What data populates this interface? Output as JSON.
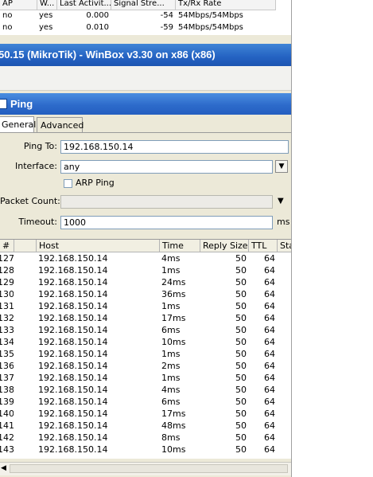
{
  "background_table": {
    "headers": [
      "AP",
      "W...",
      "Last Activit...",
      "Signal Stre...",
      "Tx/Rx Rate"
    ],
    "rows": [
      [
        "no",
        "yes",
        "0.000",
        "-54",
        "54Mbps/54Mbps"
      ],
      [
        "no",
        "yes",
        "0.010",
        "-59",
        "54Mbps/54Mbps"
      ]
    ]
  },
  "main_title": "50.15 (MikroTik) - WinBox v3.30 on x86 (x86)",
  "ping_window": {
    "title": "Ping",
    "tabs": [
      "General",
      "Advanced"
    ],
    "active_tab": "General",
    "fields": {
      "ping_to_label": "Ping To:",
      "ping_to_value": "192.168.150.14",
      "interface_label": "Interface:",
      "interface_value": "any",
      "arp_ping_label": "ARP Ping",
      "arp_ping_checked": false,
      "packet_count_label": "Packet Count:",
      "packet_count_value": "",
      "timeout_label": "Timeout:",
      "timeout_value": "1000",
      "timeout_unit": "ms"
    },
    "results": {
      "columns": [
        "#",
        "Host",
        "Time",
        "Reply Size",
        "TTL",
        "Sta"
      ],
      "rows": [
        [
          "127",
          "192.168.150.14",
          "4ms",
          "50",
          "64"
        ],
        [
          "128",
          "192.168.150.14",
          "1ms",
          "50",
          "64"
        ],
        [
          "129",
          "192.168.150.14",
          "24ms",
          "50",
          "64"
        ],
        [
          "130",
          "192.168.150.14",
          "36ms",
          "50",
          "64"
        ],
        [
          "131",
          "192.168.150.14",
          "1ms",
          "50",
          "64"
        ],
        [
          "132",
          "192.168.150.14",
          "17ms",
          "50",
          "64"
        ],
        [
          "133",
          "192.168.150.14",
          "6ms",
          "50",
          "64"
        ],
        [
          "134",
          "192.168.150.14",
          "10ms",
          "50",
          "64"
        ],
        [
          "135",
          "192.168.150.14",
          "1ms",
          "50",
          "64"
        ],
        [
          "136",
          "192.168.150.14",
          "2ms",
          "50",
          "64"
        ],
        [
          "137",
          "192.168.150.14",
          "1ms",
          "50",
          "64"
        ],
        [
          "138",
          "192.168.150.14",
          "4ms",
          "50",
          "64"
        ],
        [
          "139",
          "192.168.150.14",
          "6ms",
          "50",
          "64"
        ],
        [
          "140",
          "192.168.150.14",
          "17ms",
          "50",
          "64"
        ],
        [
          "141",
          "192.168.150.14",
          "48ms",
          "50",
          "64"
        ],
        [
          "142",
          "192.168.150.14",
          "8ms",
          "50",
          "64"
        ],
        [
          "143",
          "192.168.150.14",
          "10ms",
          "50",
          "64"
        ]
      ]
    }
  },
  "colors": {
    "title_bar": "#2462c2",
    "window_bg": "#ece9d8"
  }
}
